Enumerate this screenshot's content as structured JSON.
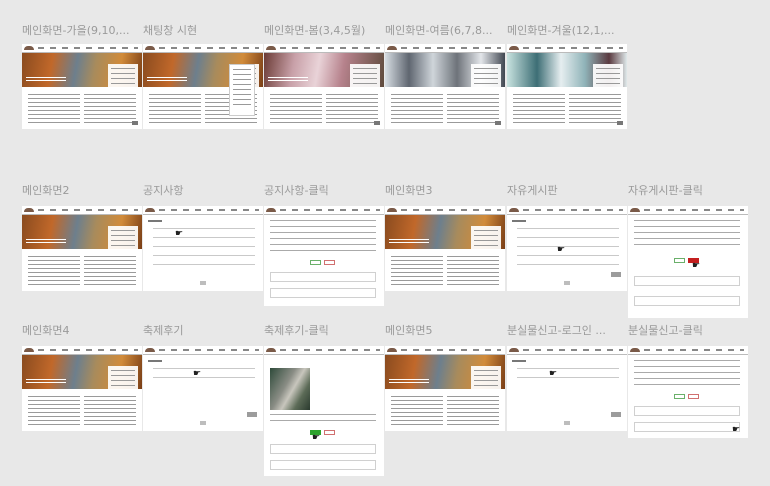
{
  "frames": [
    {
      "label": "메인화면-가을(9,10,..."
    },
    {
      "label": "채팅창 시현"
    },
    {
      "label": "메인화면-봄(3,4,5월)"
    },
    {
      "label": "메인화면-여름(6,7,8..."
    },
    {
      "label": "메인화면-겨울(12,1,..."
    },
    {
      "label": "메인화면2"
    },
    {
      "label": "공지사항"
    },
    {
      "label": "공지사항-클릭"
    },
    {
      "label": "메인화면3"
    },
    {
      "label": "자유게시판"
    },
    {
      "label": "자유게시판-클릭"
    },
    {
      "label": "메인화면4"
    },
    {
      "label": "축제후기"
    },
    {
      "label": "축제후기-클릭"
    },
    {
      "label": "메인화면5"
    },
    {
      "label": "분실물신고-로그인 ..."
    },
    {
      "label": "분실물신고-클릭"
    }
  ],
  "icons": {
    "cursor": "hand-pointer-icon"
  },
  "colors": {
    "canvas": "#e8e8e8",
    "label": "#9a9a9a",
    "accent_red": "#c41f1f",
    "accent_green": "#2fa32f"
  }
}
